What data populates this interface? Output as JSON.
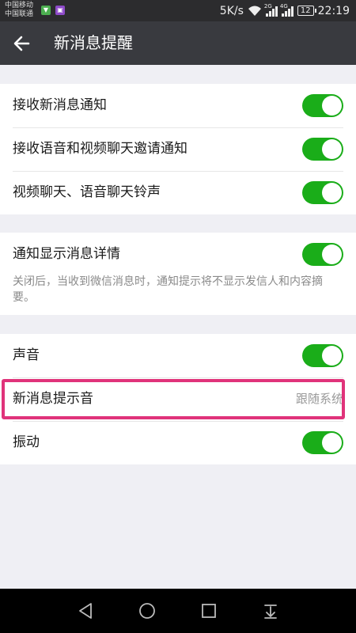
{
  "status_bar": {
    "carrier_1": "中国移动",
    "carrier_2": "中国联通",
    "speed": "5K/s",
    "signal_1_tag": "2G",
    "signal_2_tag": "4G",
    "battery": "12",
    "time": "22:19",
    "icons": [
      "app-notification-icon",
      "gallery-notification-icon",
      "wifi-icon",
      "signal-icon",
      "battery-icon"
    ]
  },
  "header": {
    "title": "新消息提醒",
    "back_icon": "arrow-left-icon"
  },
  "section_1": {
    "items": [
      {
        "label": "接收新消息通知",
        "enabled": true
      },
      {
        "label": "接收语音和视频聊天邀请通知",
        "enabled": true
      },
      {
        "label": "视频聊天、语音聊天铃声",
        "enabled": true
      }
    ]
  },
  "section_2": {
    "label": "通知显示消息详情",
    "enabled": true,
    "description": "关闭后，当收到微信消息时，通知提示将不显示发信人和内容摘要。"
  },
  "section_3": {
    "sound": {
      "label": "声音",
      "enabled": true
    },
    "tone": {
      "label": "新消息提示音",
      "value": "跟随系统"
    },
    "vibrate": {
      "label": "振动",
      "enabled": true
    }
  },
  "highlight_color": "#e0337a",
  "accent_color": "#1aad19",
  "nav": {
    "icons": [
      "back-triangle-icon",
      "home-circle-icon",
      "recents-square-icon",
      "notification-pull-icon"
    ]
  }
}
